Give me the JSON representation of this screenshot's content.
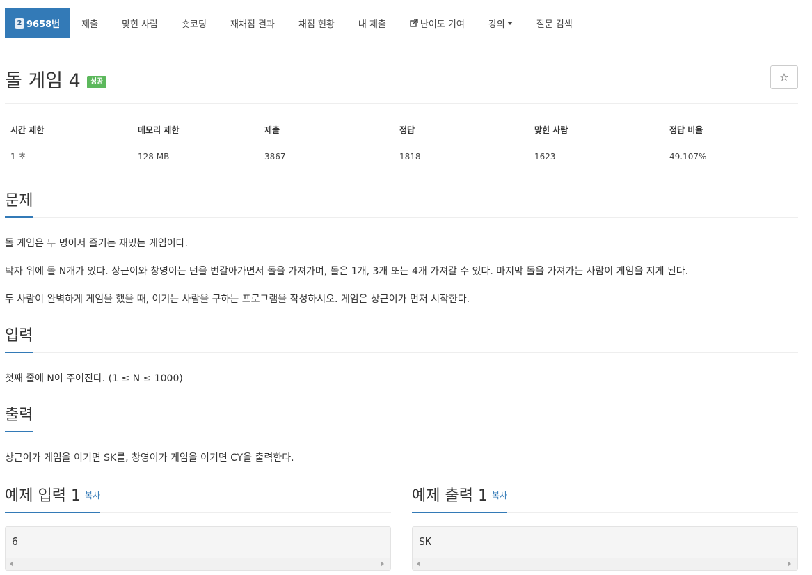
{
  "nav": {
    "problem_number": "9658번",
    "problem_icon_glyph": "2",
    "items": [
      "제출",
      "맞힌 사람",
      "숏코딩",
      "재채점 결과",
      "채점 현황",
      "내 제출",
      "난이도 기여",
      "강의",
      "질문 검색"
    ],
    "active_color": "#337ab7"
  },
  "title": {
    "text": "돌 게임 4",
    "badge": "성공",
    "badge_color": "#5cb85c",
    "star_glyph": "☆"
  },
  "info": {
    "headers": [
      "시간 제한",
      "메모리 제한",
      "제출",
      "정답",
      "맞힌 사람",
      "정답 비율"
    ],
    "values": [
      "1 초",
      "128 MB",
      "3867",
      "1818",
      "1623",
      "49.107%"
    ]
  },
  "sections": {
    "problem": {
      "title": "문제",
      "lines": [
        "돌 게임은 두 명이서 즐기는 재밌는 게임이다.",
        "탁자 위에 돌 N개가 있다. 상근이와 창영이는 턴을 번갈아가면서 돌을 가져가며, 돌은 1개, 3개 또는 4개 가져갈 수 있다. 마지막 돌을 가져가는 사람이 게임을 지게 된다.",
        "두 사람이 완벽하게 게임을 했을 때, 이기는 사람을 구하는 프로그램을 작성하시오. 게임은 상근이가 먼저 시작한다."
      ]
    },
    "input": {
      "title": "입력",
      "text": "첫째 줄에 N이 주어진다. (1 ≤ N ≤ 1000)"
    },
    "output": {
      "title": "출력",
      "text": "상근이가 게임을 이기면 SK를, 창영이가 게임을 이기면 CY을 출력한다."
    }
  },
  "samples": {
    "input": {
      "title": "예제 입력 1",
      "copy": "복사",
      "value": "6"
    },
    "output": {
      "title": "예제 출력 1",
      "copy": "복사",
      "value": "SK"
    }
  }
}
